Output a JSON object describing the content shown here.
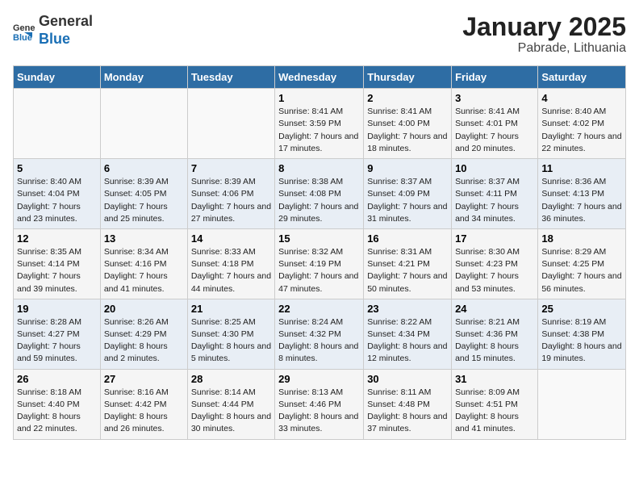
{
  "header": {
    "logo_general": "General",
    "logo_blue": "Blue",
    "title": "January 2025",
    "subtitle": "Pabrade, Lithuania"
  },
  "calendar": {
    "days_of_week": [
      "Sunday",
      "Monday",
      "Tuesday",
      "Wednesday",
      "Thursday",
      "Friday",
      "Saturday"
    ],
    "weeks": [
      [
        {
          "day": "",
          "info": ""
        },
        {
          "day": "",
          "info": ""
        },
        {
          "day": "",
          "info": ""
        },
        {
          "day": "1",
          "info": "Sunrise: 8:41 AM\nSunset: 3:59 PM\nDaylight: 7 hours\nand 17 minutes."
        },
        {
          "day": "2",
          "info": "Sunrise: 8:41 AM\nSunset: 4:00 PM\nDaylight: 7 hours\nand 18 minutes."
        },
        {
          "day": "3",
          "info": "Sunrise: 8:41 AM\nSunset: 4:01 PM\nDaylight: 7 hours\nand 20 minutes."
        },
        {
          "day": "4",
          "info": "Sunrise: 8:40 AM\nSunset: 4:02 PM\nDaylight: 7 hours\nand 22 minutes."
        }
      ],
      [
        {
          "day": "5",
          "info": "Sunrise: 8:40 AM\nSunset: 4:04 PM\nDaylight: 7 hours\nand 23 minutes."
        },
        {
          "day": "6",
          "info": "Sunrise: 8:39 AM\nSunset: 4:05 PM\nDaylight: 7 hours\nand 25 minutes."
        },
        {
          "day": "7",
          "info": "Sunrise: 8:39 AM\nSunset: 4:06 PM\nDaylight: 7 hours\nand 27 minutes."
        },
        {
          "day": "8",
          "info": "Sunrise: 8:38 AM\nSunset: 4:08 PM\nDaylight: 7 hours\nand 29 minutes."
        },
        {
          "day": "9",
          "info": "Sunrise: 8:37 AM\nSunset: 4:09 PM\nDaylight: 7 hours\nand 31 minutes."
        },
        {
          "day": "10",
          "info": "Sunrise: 8:37 AM\nSunset: 4:11 PM\nDaylight: 7 hours\nand 34 minutes."
        },
        {
          "day": "11",
          "info": "Sunrise: 8:36 AM\nSunset: 4:13 PM\nDaylight: 7 hours\nand 36 minutes."
        }
      ],
      [
        {
          "day": "12",
          "info": "Sunrise: 8:35 AM\nSunset: 4:14 PM\nDaylight: 7 hours\nand 39 minutes."
        },
        {
          "day": "13",
          "info": "Sunrise: 8:34 AM\nSunset: 4:16 PM\nDaylight: 7 hours\nand 41 minutes."
        },
        {
          "day": "14",
          "info": "Sunrise: 8:33 AM\nSunset: 4:18 PM\nDaylight: 7 hours\nand 44 minutes."
        },
        {
          "day": "15",
          "info": "Sunrise: 8:32 AM\nSunset: 4:19 PM\nDaylight: 7 hours\nand 47 minutes."
        },
        {
          "day": "16",
          "info": "Sunrise: 8:31 AM\nSunset: 4:21 PM\nDaylight: 7 hours\nand 50 minutes."
        },
        {
          "day": "17",
          "info": "Sunrise: 8:30 AM\nSunset: 4:23 PM\nDaylight: 7 hours\nand 53 minutes."
        },
        {
          "day": "18",
          "info": "Sunrise: 8:29 AM\nSunset: 4:25 PM\nDaylight: 7 hours\nand 56 minutes."
        }
      ],
      [
        {
          "day": "19",
          "info": "Sunrise: 8:28 AM\nSunset: 4:27 PM\nDaylight: 7 hours\nand 59 minutes."
        },
        {
          "day": "20",
          "info": "Sunrise: 8:26 AM\nSunset: 4:29 PM\nDaylight: 8 hours\nand 2 minutes."
        },
        {
          "day": "21",
          "info": "Sunrise: 8:25 AM\nSunset: 4:30 PM\nDaylight: 8 hours\nand 5 minutes."
        },
        {
          "day": "22",
          "info": "Sunrise: 8:24 AM\nSunset: 4:32 PM\nDaylight: 8 hours\nand 8 minutes."
        },
        {
          "day": "23",
          "info": "Sunrise: 8:22 AM\nSunset: 4:34 PM\nDaylight: 8 hours\nand 12 minutes."
        },
        {
          "day": "24",
          "info": "Sunrise: 8:21 AM\nSunset: 4:36 PM\nDaylight: 8 hours\nand 15 minutes."
        },
        {
          "day": "25",
          "info": "Sunrise: 8:19 AM\nSunset: 4:38 PM\nDaylight: 8 hours\nand 19 minutes."
        }
      ],
      [
        {
          "day": "26",
          "info": "Sunrise: 8:18 AM\nSunset: 4:40 PM\nDaylight: 8 hours\nand 22 minutes."
        },
        {
          "day": "27",
          "info": "Sunrise: 8:16 AM\nSunset: 4:42 PM\nDaylight: 8 hours\nand 26 minutes."
        },
        {
          "day": "28",
          "info": "Sunrise: 8:14 AM\nSunset: 4:44 PM\nDaylight: 8 hours\nand 30 minutes."
        },
        {
          "day": "29",
          "info": "Sunrise: 8:13 AM\nSunset: 4:46 PM\nDaylight: 8 hours\nand 33 minutes."
        },
        {
          "day": "30",
          "info": "Sunrise: 8:11 AM\nSunset: 4:48 PM\nDaylight: 8 hours\nand 37 minutes."
        },
        {
          "day": "31",
          "info": "Sunrise: 8:09 AM\nSunset: 4:51 PM\nDaylight: 8 hours\nand 41 minutes."
        },
        {
          "day": "",
          "info": ""
        }
      ]
    ]
  }
}
